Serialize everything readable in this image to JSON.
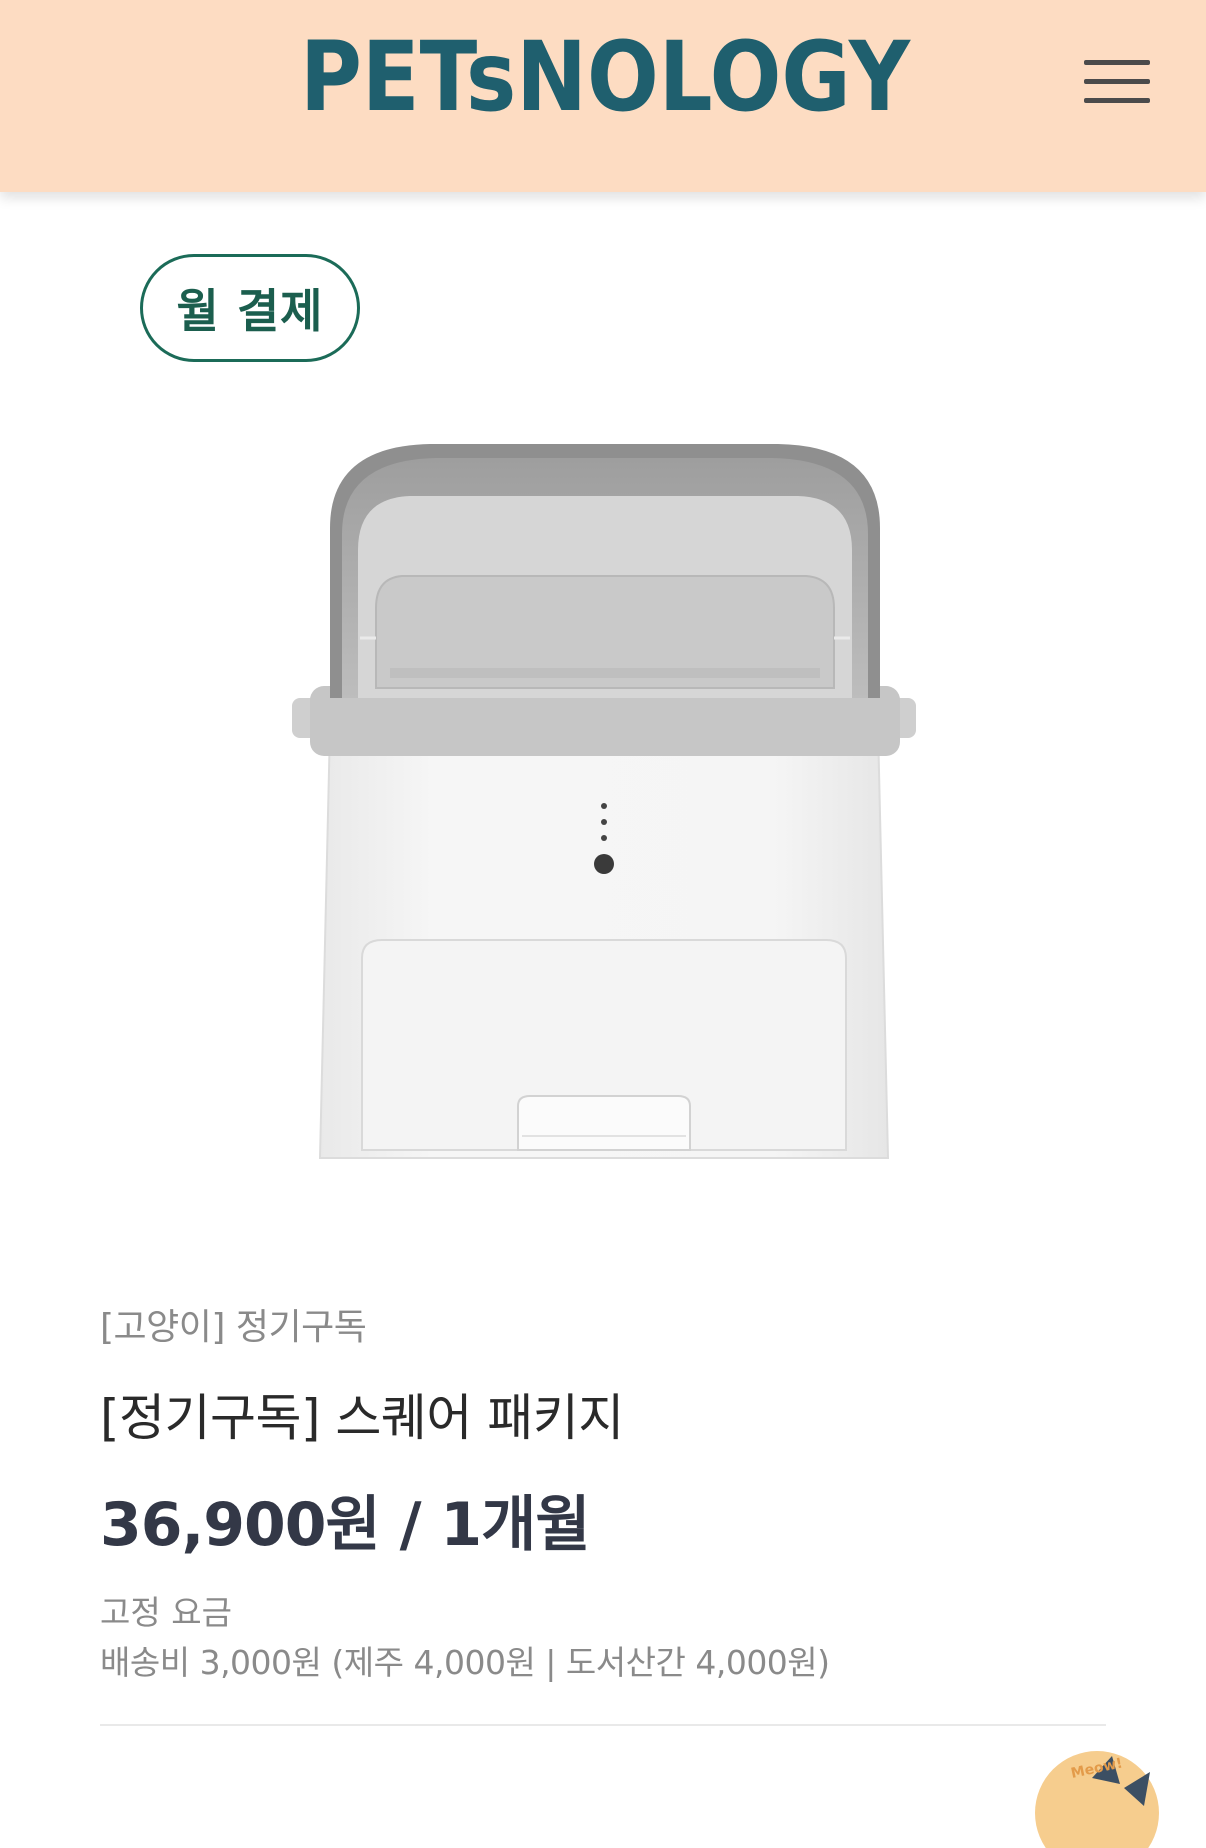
{
  "header": {
    "logo_text": "PETsNOLOGY",
    "menu_label": "menu"
  },
  "badge": {
    "label": "월 결제"
  },
  "product": {
    "category": "[고양이] 정기구독",
    "title": "[정기구독] 스퀘어 패키지",
    "price": "36,900원 / 1개월",
    "fee_type": "고정 요금",
    "shipping": "배송비 3,000원 (제주 4,000원 | 도서산간 4,000원)"
  },
  "floating_button": {
    "text": "Meow!"
  },
  "colors": {
    "header_bg": "#fddcc2",
    "logo": "#1f5f6e",
    "badge": "#1b6b58",
    "price": "#333847"
  },
  "icons": [
    "hamburger-menu-icon",
    "cat-chat-icon"
  ]
}
